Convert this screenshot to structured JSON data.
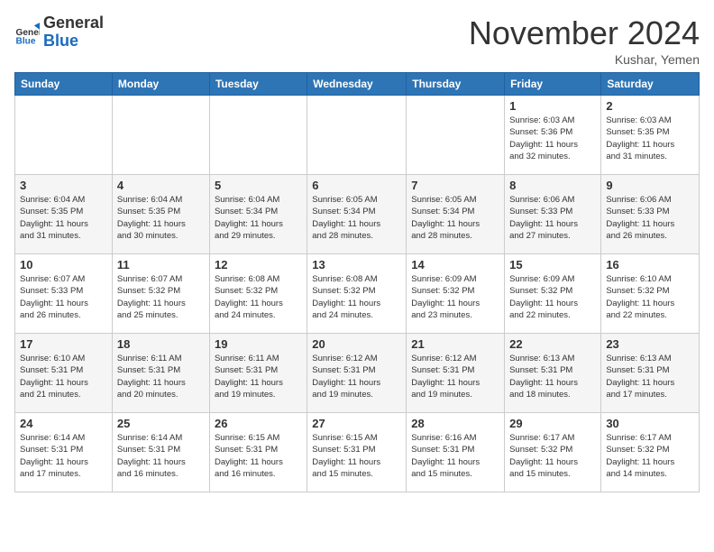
{
  "header": {
    "logo_line1": "General",
    "logo_line2": "Blue",
    "month_title": "November 2024",
    "location": "Kushar, Yemen"
  },
  "days_of_week": [
    "Sunday",
    "Monday",
    "Tuesday",
    "Wednesday",
    "Thursday",
    "Friday",
    "Saturday"
  ],
  "weeks": [
    [
      {
        "day": "",
        "info": ""
      },
      {
        "day": "",
        "info": ""
      },
      {
        "day": "",
        "info": ""
      },
      {
        "day": "",
        "info": ""
      },
      {
        "day": "",
        "info": ""
      },
      {
        "day": "1",
        "info": "Sunrise: 6:03 AM\nSunset: 5:36 PM\nDaylight: 11 hours\nand 32 minutes."
      },
      {
        "day": "2",
        "info": "Sunrise: 6:03 AM\nSunset: 5:35 PM\nDaylight: 11 hours\nand 31 minutes."
      }
    ],
    [
      {
        "day": "3",
        "info": "Sunrise: 6:04 AM\nSunset: 5:35 PM\nDaylight: 11 hours\nand 31 minutes."
      },
      {
        "day": "4",
        "info": "Sunrise: 6:04 AM\nSunset: 5:35 PM\nDaylight: 11 hours\nand 30 minutes."
      },
      {
        "day": "5",
        "info": "Sunrise: 6:04 AM\nSunset: 5:34 PM\nDaylight: 11 hours\nand 29 minutes."
      },
      {
        "day": "6",
        "info": "Sunrise: 6:05 AM\nSunset: 5:34 PM\nDaylight: 11 hours\nand 28 minutes."
      },
      {
        "day": "7",
        "info": "Sunrise: 6:05 AM\nSunset: 5:34 PM\nDaylight: 11 hours\nand 28 minutes."
      },
      {
        "day": "8",
        "info": "Sunrise: 6:06 AM\nSunset: 5:33 PM\nDaylight: 11 hours\nand 27 minutes."
      },
      {
        "day": "9",
        "info": "Sunrise: 6:06 AM\nSunset: 5:33 PM\nDaylight: 11 hours\nand 26 minutes."
      }
    ],
    [
      {
        "day": "10",
        "info": "Sunrise: 6:07 AM\nSunset: 5:33 PM\nDaylight: 11 hours\nand 26 minutes."
      },
      {
        "day": "11",
        "info": "Sunrise: 6:07 AM\nSunset: 5:32 PM\nDaylight: 11 hours\nand 25 minutes."
      },
      {
        "day": "12",
        "info": "Sunrise: 6:08 AM\nSunset: 5:32 PM\nDaylight: 11 hours\nand 24 minutes."
      },
      {
        "day": "13",
        "info": "Sunrise: 6:08 AM\nSunset: 5:32 PM\nDaylight: 11 hours\nand 24 minutes."
      },
      {
        "day": "14",
        "info": "Sunrise: 6:09 AM\nSunset: 5:32 PM\nDaylight: 11 hours\nand 23 minutes."
      },
      {
        "day": "15",
        "info": "Sunrise: 6:09 AM\nSunset: 5:32 PM\nDaylight: 11 hours\nand 22 minutes."
      },
      {
        "day": "16",
        "info": "Sunrise: 6:10 AM\nSunset: 5:32 PM\nDaylight: 11 hours\nand 22 minutes."
      }
    ],
    [
      {
        "day": "17",
        "info": "Sunrise: 6:10 AM\nSunset: 5:31 PM\nDaylight: 11 hours\nand 21 minutes."
      },
      {
        "day": "18",
        "info": "Sunrise: 6:11 AM\nSunset: 5:31 PM\nDaylight: 11 hours\nand 20 minutes."
      },
      {
        "day": "19",
        "info": "Sunrise: 6:11 AM\nSunset: 5:31 PM\nDaylight: 11 hours\nand 19 minutes."
      },
      {
        "day": "20",
        "info": "Sunrise: 6:12 AM\nSunset: 5:31 PM\nDaylight: 11 hours\nand 19 minutes."
      },
      {
        "day": "21",
        "info": "Sunrise: 6:12 AM\nSunset: 5:31 PM\nDaylight: 11 hours\nand 19 minutes."
      },
      {
        "day": "22",
        "info": "Sunrise: 6:13 AM\nSunset: 5:31 PM\nDaylight: 11 hours\nand 18 minutes."
      },
      {
        "day": "23",
        "info": "Sunrise: 6:13 AM\nSunset: 5:31 PM\nDaylight: 11 hours\nand 17 minutes."
      }
    ],
    [
      {
        "day": "24",
        "info": "Sunrise: 6:14 AM\nSunset: 5:31 PM\nDaylight: 11 hours\nand 17 minutes."
      },
      {
        "day": "25",
        "info": "Sunrise: 6:14 AM\nSunset: 5:31 PM\nDaylight: 11 hours\nand 16 minutes."
      },
      {
        "day": "26",
        "info": "Sunrise: 6:15 AM\nSunset: 5:31 PM\nDaylight: 11 hours\nand 16 minutes."
      },
      {
        "day": "27",
        "info": "Sunrise: 6:15 AM\nSunset: 5:31 PM\nDaylight: 11 hours\nand 15 minutes."
      },
      {
        "day": "28",
        "info": "Sunrise: 6:16 AM\nSunset: 5:31 PM\nDaylight: 11 hours\nand 15 minutes."
      },
      {
        "day": "29",
        "info": "Sunrise: 6:17 AM\nSunset: 5:32 PM\nDaylight: 11 hours\nand 15 minutes."
      },
      {
        "day": "30",
        "info": "Sunrise: 6:17 AM\nSunset: 5:32 PM\nDaylight: 11 hours\nand 14 minutes."
      }
    ]
  ]
}
